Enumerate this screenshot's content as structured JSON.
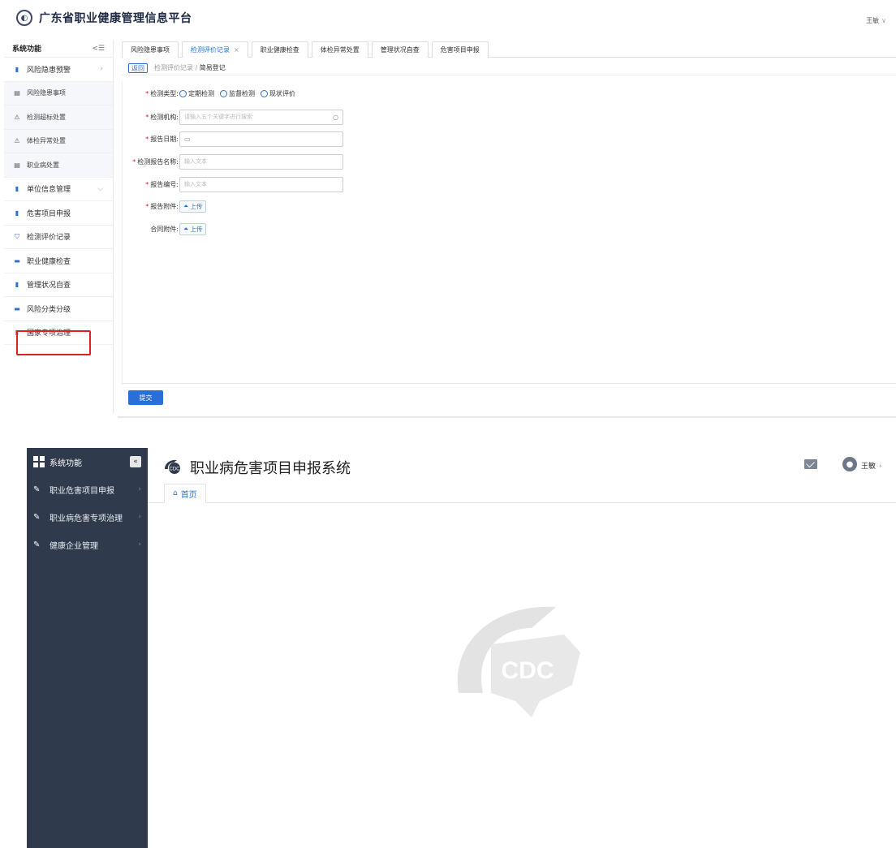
{
  "top": {
    "header": {
      "title": "广东省职业健康管理信息平台",
      "user": "王敏",
      "user_chevron": "∨"
    },
    "sidebar": {
      "header": "系统功能",
      "collapse_icon": "<☰",
      "items": [
        {
          "label": "风险隐患预警",
          "icon": "doc-icon",
          "glyph": "▮",
          "arrow": "›",
          "sub": false
        },
        {
          "label": "风险隐患事项",
          "icon": "list-icon",
          "glyph": "▤",
          "arrow": "",
          "sub": true
        },
        {
          "label": "检测超标处置",
          "icon": "warning-icon",
          "glyph": "⚠",
          "arrow": "",
          "sub": true
        },
        {
          "label": "体检异常处置",
          "icon": "warning-icon",
          "glyph": "⚠",
          "arrow": "",
          "sub": true
        },
        {
          "label": "职业病处置",
          "icon": "list-icon",
          "glyph": "▤",
          "arrow": "",
          "sub": true
        },
        {
          "label": "单位信息管理",
          "icon": "doc-icon",
          "glyph": "▮",
          "arrow": "⌵",
          "sub": false
        },
        {
          "label": "危害项目申报",
          "icon": "doc-icon",
          "glyph": "▮",
          "arrow": "",
          "sub": false
        },
        {
          "label": "检测评价记录",
          "icon": "shield-icon",
          "glyph": "⛉",
          "arrow": "",
          "sub": false
        },
        {
          "label": "职业健康检查",
          "icon": "monitor-icon",
          "glyph": "▬",
          "arrow": "",
          "sub": false
        },
        {
          "label": "管理状况自查",
          "icon": "doc-icon",
          "glyph": "▮",
          "arrow": "",
          "sub": false
        },
        {
          "label": "风险分类分级",
          "icon": "monitor-icon",
          "glyph": "▬",
          "arrow": "",
          "sub": false
        },
        {
          "label": "国家专项治理",
          "icon": "doc-icon",
          "glyph": "▮",
          "arrow": "",
          "sub": false
        }
      ]
    },
    "tabs": [
      {
        "label": "风险隐患事项",
        "active": false
      },
      {
        "label": "检测评价记录",
        "active": true,
        "close": "×"
      },
      {
        "label": "职业健康检查",
        "active": false
      },
      {
        "label": "体检异常处置",
        "active": false
      },
      {
        "label": "管理状况自查",
        "active": false
      },
      {
        "label": "危害项目申报",
        "active": false
      }
    ],
    "breadcrumb": {
      "back": "返回",
      "parent": "检测评价记录",
      "sep": " / ",
      "current": "简易登记"
    },
    "form": {
      "detect_type": {
        "label": "检测类型:",
        "options": [
          "定期检测",
          "监督检测",
          "现状评价"
        ]
      },
      "agency": {
        "label": "检测机构:",
        "placeholder": "请输入五个关键字进行搜索"
      },
      "report_date": {
        "label": "报告日期:"
      },
      "report_name": {
        "label": "检测报告名称:",
        "placeholder": "输入文本"
      },
      "report_no": {
        "label": "报告编号:",
        "placeholder": "输入文本"
      },
      "report_attach": {
        "label": "报告附件:",
        "button": "上传"
      },
      "contract_attach": {
        "label": "合同附件:",
        "button": "上传"
      },
      "required_mark": "*"
    },
    "submit": "提交"
  },
  "bottom": {
    "sidebar": {
      "header": "系统功能",
      "items": [
        {
          "label": "职业危害项目申报",
          "icon": "edit-icon"
        },
        {
          "label": "职业病危害专项治理",
          "icon": "edit-icon"
        },
        {
          "label": "健康企业管理",
          "icon": "edit-icon"
        }
      ]
    },
    "header": {
      "title": "职业病危害项目申报系统",
      "user": "王敏"
    },
    "tab": {
      "label": "首页"
    },
    "watermark": "CDC"
  },
  "colors": {
    "accent": "#2a6fd6",
    "dark_sidebar": "#2f3a4c",
    "required": "#e02020"
  }
}
